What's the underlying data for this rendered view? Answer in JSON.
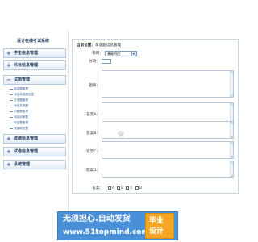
{
  "sidebar": {
    "title": "设计在线考试系统",
    "sections": [
      {
        "icon": "+",
        "label": "学生信息管理"
      },
      {
        "icon": "+",
        "label": "科目信息管理"
      },
      {
        "icon": "−",
        "label": "试题管理"
      },
      {
        "icon": "+",
        "label": "成绩信息管理"
      },
      {
        "icon": "+",
        "label": "试卷信息管理"
      },
      {
        "icon": "+",
        "label": "系统管理"
      }
    ],
    "sub_items": [
      "单选题管理",
      "添加单选题信息",
      "多选题管理",
      "添加多选题",
      "判断题管理",
      "添加判断题",
      "填空题管理",
      "添加填空题"
    ]
  },
  "main": {
    "location_prefix": "当前位置：",
    "location_text": "单选题信息管理",
    "subject_label": "科目：",
    "subject_value": "基础科目",
    "score_label": "分数：",
    "question_label": "题目：",
    "option_a_label": "答案A：",
    "option_b_label": "答案B：",
    "option_c_label": "答案C：",
    "option_d_label": "答案D：",
    "answer_label": "答案：",
    "answer_options": [
      "A",
      "B",
      "C",
      "D"
    ]
  },
  "watermark": {
    "slogan": "无须担心.自动发货",
    "url": "www.51topmind.com",
    "badge_line1": "毕业",
    "badge_line2": "设计"
  }
}
